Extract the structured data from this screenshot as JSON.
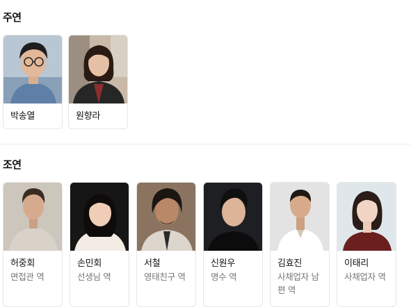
{
  "main_cast": {
    "title": "주연",
    "people": [
      {
        "name": "박송열",
        "role": ""
      },
      {
        "name": "원향라",
        "role": ""
      }
    ]
  },
  "supporting_cast": {
    "title": "조연",
    "people": [
      {
        "name": "허중회",
        "role": "면접관 역"
      },
      {
        "name": "손민회",
        "role": "선생님 역"
      },
      {
        "name": "서철",
        "role": "영태친구 역"
      },
      {
        "name": "신원우",
        "role": "명수 역"
      },
      {
        "name": "김효진",
        "role": "사채업자 남편 역"
      },
      {
        "name": "이태리",
        "role": "사채업자 역"
      }
    ]
  }
}
